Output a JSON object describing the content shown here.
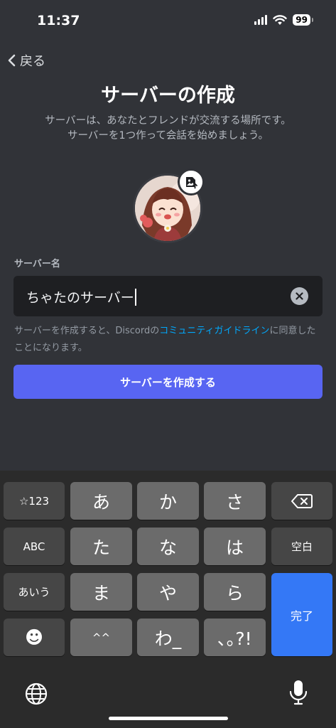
{
  "status": {
    "time": "11:37",
    "battery": "99"
  },
  "header": {
    "back_label": "戻る",
    "title": "サーバーの作成",
    "description_lines": [
      "サーバーは、あなたとフレンドが交流する場所です。",
      "サーバーを1つ作って会話を始めましょう。"
    ]
  },
  "form": {
    "field_label": "サーバー名",
    "server_name_value": "ちゃたのサーバー",
    "notice_prefix": "サーバーを作成すると、Discordの",
    "notice_link": "コミュニティガイドライン",
    "notice_suffix": "に同意したことになります。",
    "create_button": "サーバーを作成する"
  },
  "keyboard": {
    "rows": [
      [
        "☆123",
        "あ",
        "か",
        "さ",
        "⌫"
      ],
      [
        "ABC",
        "た",
        "な",
        "は",
        "空白"
      ],
      [
        "あいう",
        "ま",
        "や",
        "ら",
        "完了"
      ],
      [
        "☻",
        "^^",
        "わ_",
        "､｡?!"
      ]
    ],
    "globe_icon": "globe-icon",
    "mic_icon": "microphone-icon"
  },
  "colors": {
    "background": "#313338",
    "accent": "#5865f2",
    "link": "#00a8fc",
    "done_key": "#3478f6"
  }
}
